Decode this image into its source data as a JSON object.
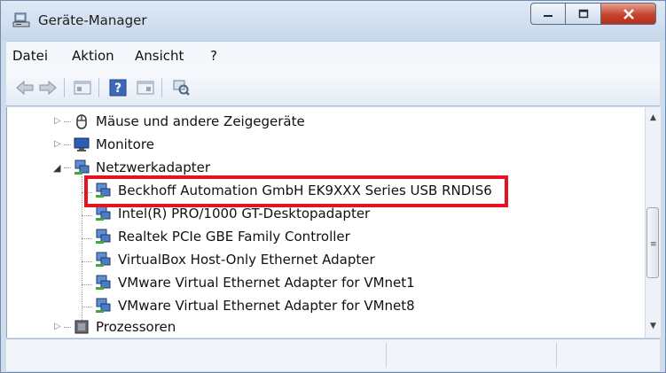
{
  "window": {
    "title": "Geräte-Manager"
  },
  "menu": {
    "items": [
      "Datei",
      "Aktion",
      "Ansicht",
      "?"
    ]
  },
  "tree": {
    "nodes": [
      {
        "label": "Mäuse und andere Zeigegeräte",
        "type": "category",
        "expanded": false,
        "icon": "mouse-icon"
      },
      {
        "label": "Monitore",
        "type": "category",
        "expanded": false,
        "icon": "monitor-icon"
      },
      {
        "label": "Netzwerkadapter",
        "type": "category",
        "expanded": true,
        "icon": "network-adapter-icon"
      },
      {
        "label": "Beckhoff Automation GmbH EK9XXX Series USB RNDIS6",
        "type": "device",
        "highlighted": true,
        "icon": "network-adapter-icon"
      },
      {
        "label": "Intel(R) PRO/1000 GT-Desktopadapter",
        "type": "device",
        "icon": "network-adapter-icon"
      },
      {
        "label": "Realtek PCIe GBE Family Controller",
        "type": "device",
        "icon": "network-adapter-icon"
      },
      {
        "label": "VirtualBox Host-Only Ethernet Adapter",
        "type": "device",
        "icon": "network-adapter-icon"
      },
      {
        "label": "VMware Virtual Ethernet Adapter for VMnet1",
        "type": "device",
        "icon": "network-adapter-icon"
      },
      {
        "label": "VMware Virtual Ethernet Adapter for VMnet8",
        "type": "device",
        "icon": "network-adapter-icon"
      },
      {
        "label": "Prozessoren",
        "type": "category",
        "expanded": false,
        "icon": "processor-icon"
      }
    ]
  },
  "colors": {
    "highlight": "#e8121f",
    "close_button": "#c4432d"
  }
}
